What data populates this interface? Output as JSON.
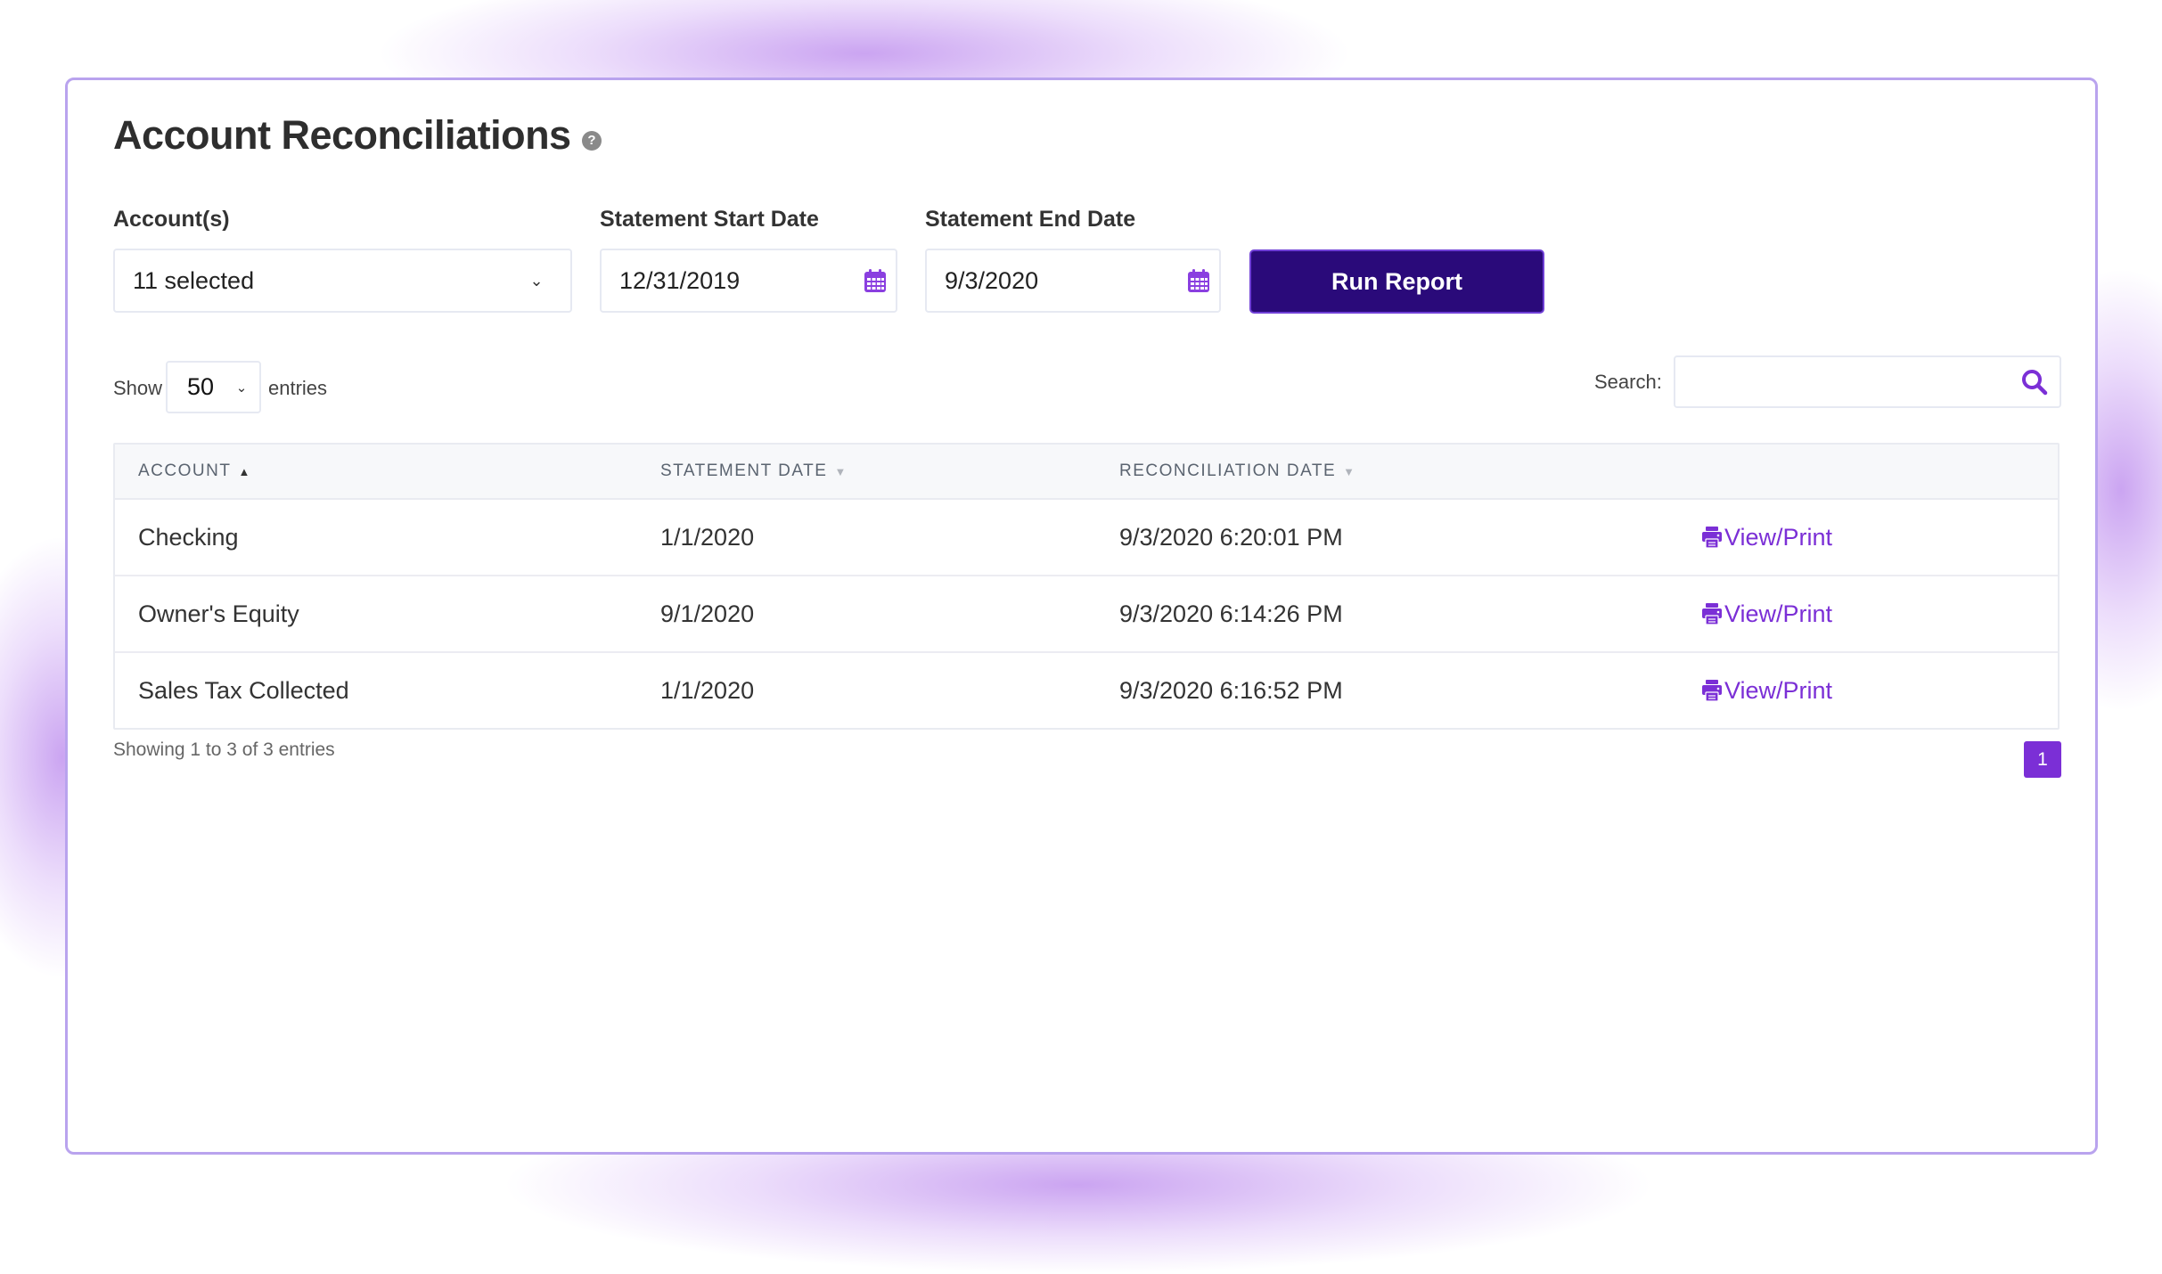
{
  "page": {
    "title": "Account Reconciliations",
    "help_icon": "question-circle-icon"
  },
  "filters": {
    "accounts_label": "Account(s)",
    "accounts_value": "11 selected",
    "start_label": "Statement Start Date",
    "start_value": "12/31/2019",
    "end_label": "Statement End Date",
    "end_value": "9/3/2020",
    "run_label": "Run Report"
  },
  "length": {
    "show_label": "Show",
    "value": "50",
    "entries_label": "entries"
  },
  "search": {
    "label": "Search:",
    "value": "",
    "placeholder": ""
  },
  "table": {
    "columns": [
      {
        "label": "ACCOUNT",
        "sort": "▲"
      },
      {
        "label": "STATEMENT DATE",
        "sort": "▼"
      },
      {
        "label": "RECONCILIATION DATE",
        "sort": "▼"
      },
      {
        "label": "",
        "sort": ""
      }
    ],
    "rows": [
      {
        "account": "Checking",
        "statement_date": "1/1/2020",
        "reconciliation_date": "9/3/2020 6:20:01 PM",
        "action": "View/Print"
      },
      {
        "account": "Owner's Equity",
        "statement_date": "9/1/2020",
        "reconciliation_date": "9/3/2020 6:14:26 PM",
        "action": "View/Print"
      },
      {
        "account": "Sales Tax Collected",
        "statement_date": "1/1/2020",
        "reconciliation_date": "9/3/2020 6:16:52 PM",
        "action": "View/Print"
      }
    ]
  },
  "footer": {
    "info": "Showing 1 to 3 of 3 entries",
    "current_page": "1"
  },
  "colors": {
    "accent": "#7b2fd6",
    "button_bg": "#2a0a7a",
    "card_border": "#b9a3ee"
  }
}
